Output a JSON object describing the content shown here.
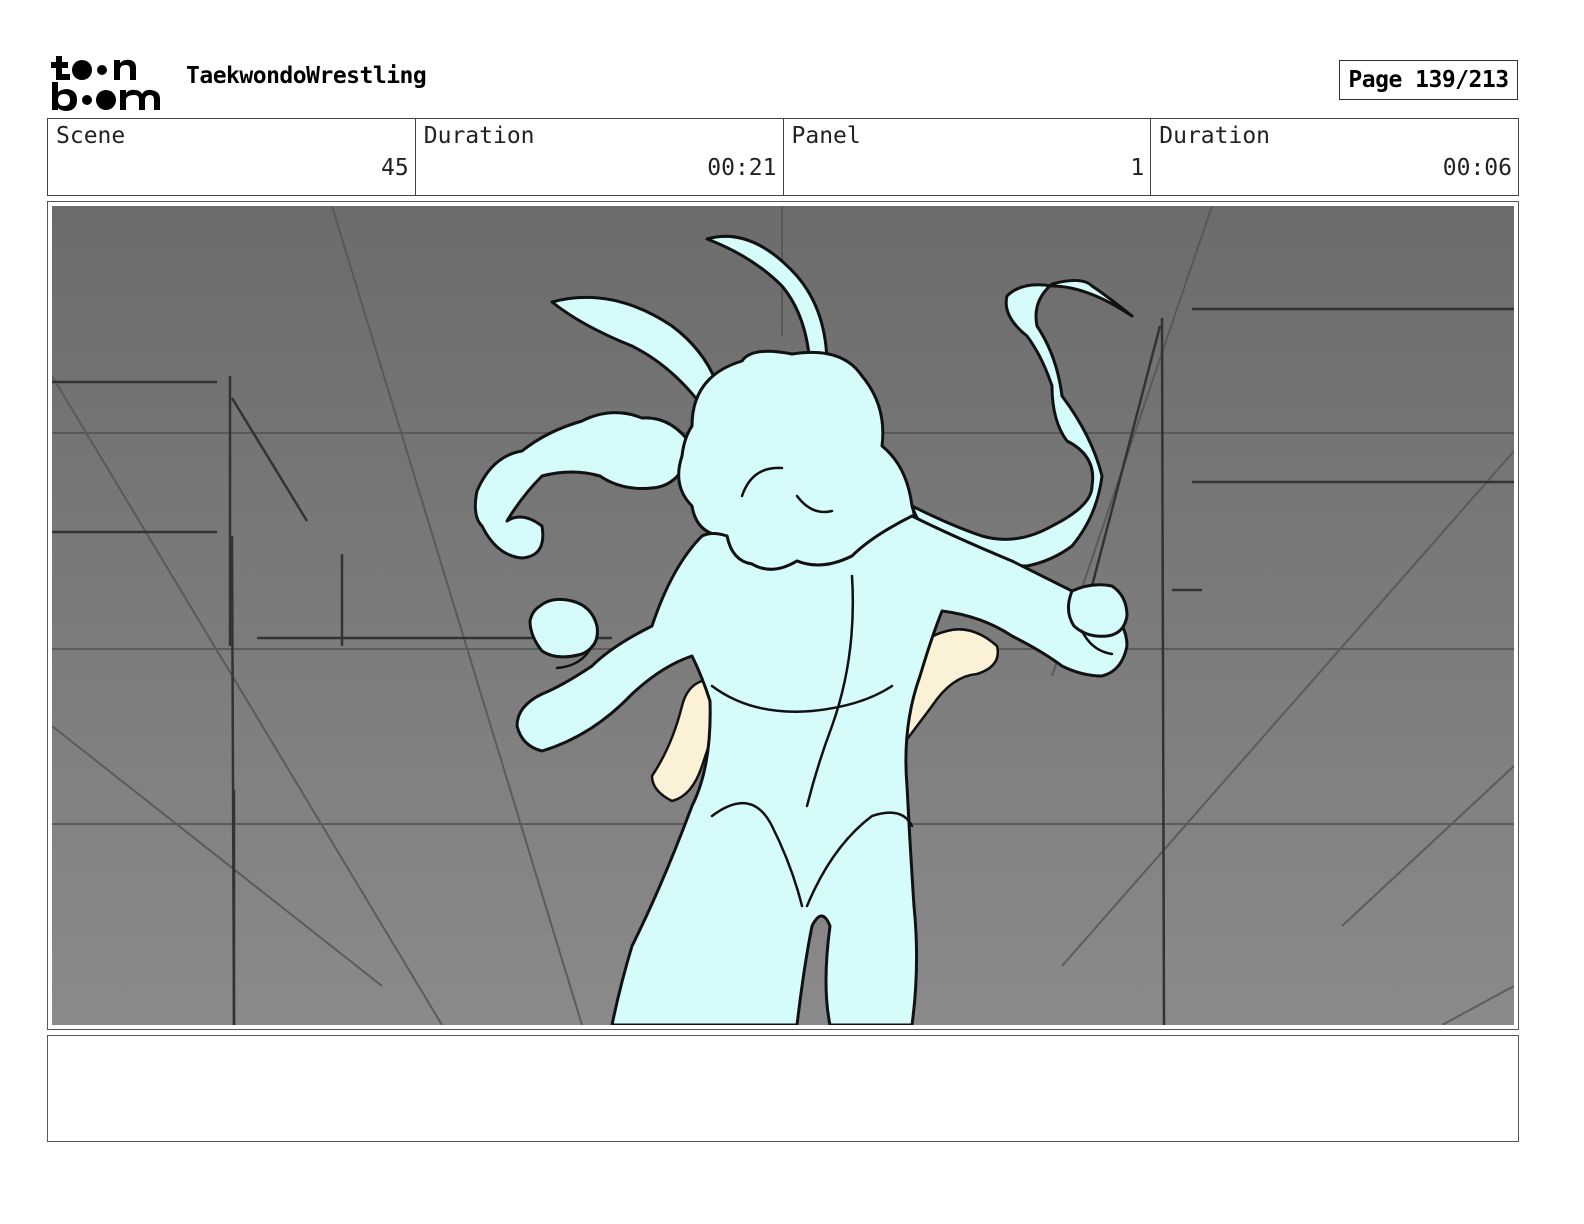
{
  "header": {
    "project_title": "TaekwondoWrestling",
    "page_label": "Page 139/213"
  },
  "logo": {
    "icon": "toonboom-logo",
    "text": "toon boom"
  },
  "info": {
    "scene_label": "Scene",
    "scene_value": "45",
    "scene_duration_label": "Duration",
    "scene_duration_value": "00:21",
    "panel_label": "Panel",
    "panel_value": "1",
    "panel_duration_label": "Duration",
    "panel_duration_value": "00:06"
  },
  "panel": {
    "background_color": "#7a7a7a",
    "character_fill": "#d6fbfb",
    "opponent_fill": "#fbf1d6"
  },
  "notes": {
    "text": ""
  }
}
